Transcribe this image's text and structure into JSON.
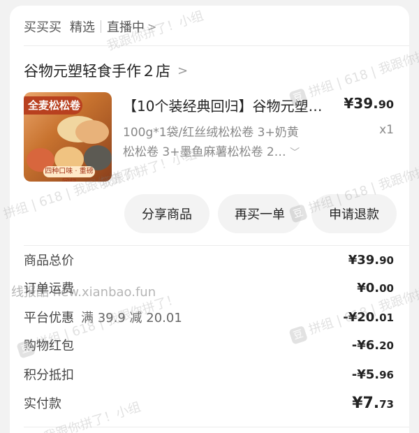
{
  "topbar": {
    "item1": "买买买",
    "item2": "精选",
    "item3": "直播中",
    "chevron": ">"
  },
  "shop": {
    "name": "谷物元塑轻食手作２店",
    "chevron": ">"
  },
  "product": {
    "thumb_badge": "全麦松松卷",
    "thumb_footer": "四种口味 · 重磅回归",
    "title": "【10个装经典回归】谷物元塑…",
    "price_main": "¥39.",
    "price_dec": "90",
    "spec_line1": "100g*1袋/红丝绒松松卷 3+奶黄",
    "spec_line2": "松松卷 3+墨鱼麻薯松松卷 2…",
    "quantity": "x1"
  },
  "actions": {
    "share": "分享商品",
    "rebuy": "再买一单",
    "refund": "申请退款"
  },
  "summary": [
    {
      "label": "商品总价",
      "sub": "",
      "value_main": "¥39.",
      "value_dec": "90"
    },
    {
      "label": "订单运费",
      "sub": "",
      "value_main": "¥0.",
      "value_dec": "00"
    },
    {
      "label": "平台优惠",
      "sub": "满 39.9 减 20.01",
      "value_main": "-¥20.",
      "value_dec": "01"
    },
    {
      "label": "购物红包",
      "sub": "",
      "value_main": "-¥6.",
      "value_dec": "20"
    },
    {
      "label": "积分抵扣",
      "sub": "",
      "value_main": "-¥5.",
      "value_dec": "96"
    },
    {
      "label": "实付款",
      "sub": "",
      "value_main": "¥7.",
      "value_dec": "73"
    }
  ],
  "watermarks": {
    "wm_a": "我跟你拼了！小组",
    "wm_b": "拼组 | 618 | 我跟你拼了！",
    "wm_c": "线报酷 new.xianbao.fun",
    "logo": "豆"
  }
}
